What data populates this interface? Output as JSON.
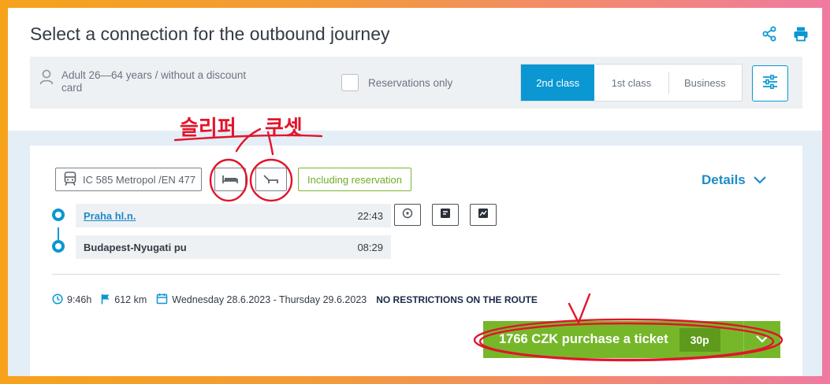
{
  "header": {
    "title": "Select a connection for the outbound journey"
  },
  "icons": {
    "share": "share-icon",
    "print": "print-icon",
    "settings": "sliders-icon"
  },
  "filters": {
    "passenger": "Adult 26—64 years / without a discount card",
    "reservations_only": "Reservations only",
    "classes": [
      "2nd class",
      "1st class",
      "Business"
    ],
    "active_class": "2nd class"
  },
  "annotations": {
    "sleeper": "슬리퍼",
    "couchette": "쿠셋"
  },
  "connection": {
    "train": "IC 585 Metropol /EN 477",
    "reservation_badge": "Including reservation",
    "details_label": "Details",
    "from": {
      "station": "Praha hl.n.",
      "time": "22:43"
    },
    "to": {
      "station": "Budapest-Nyugati pu",
      "time": "08:29"
    },
    "duration": "9:46h",
    "distance": "612 km",
    "dates": "Wednesday 28.6.2023 - Thursday 29.6.2023",
    "restrictions": "NO RESTRICTIONS ON THE ROUTE",
    "purchase_label": "1766 CZK purchase a ticket",
    "purchase_badge": "30p"
  },
  "colors": {
    "accent": "#0a97d2",
    "buy": "#76b72a",
    "annotation": "#e2142b"
  }
}
